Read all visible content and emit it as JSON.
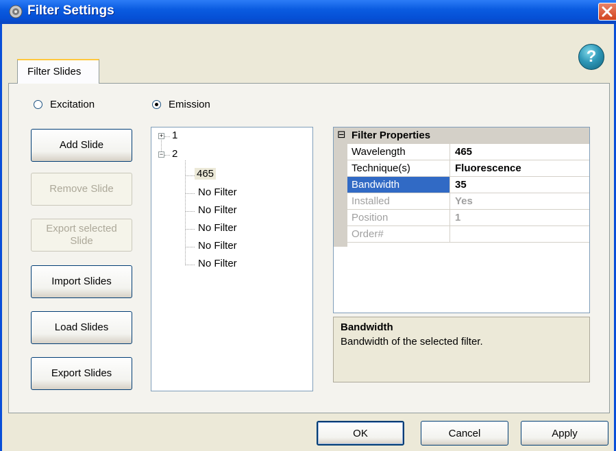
{
  "window": {
    "title": "Filter Settings"
  },
  "tabs": [
    {
      "label": "Filter Slides"
    }
  ],
  "help": {
    "glyph": "?"
  },
  "radios": {
    "excitation": {
      "label": "Excitation",
      "checked": false
    },
    "emission": {
      "label": "Emission",
      "checked": true
    }
  },
  "buttons": {
    "add_slide": "Add Slide",
    "remove_slide": "Remove Slide",
    "export_selected_line1": "Export selected",
    "export_selected_line2": "Slide",
    "import_slides": "Import Slides",
    "load_slides": "Load Slides",
    "export_slides": "Export Slides"
  },
  "tree": {
    "nodes": [
      {
        "label": "1",
        "expanded": false
      },
      {
        "label": "2",
        "expanded": true,
        "children": [
          "465",
          "No Filter",
          "No Filter",
          "No Filter",
          "No Filter",
          "No Filter"
        ]
      }
    ],
    "selected_child": "465"
  },
  "property_grid": {
    "category": "Filter Properties",
    "collapse_glyph": "⊟",
    "rows": [
      {
        "name": "Wavelength",
        "value": "465"
      },
      {
        "name": "Technique(s)",
        "value": "Fluorescence"
      },
      {
        "name": "Bandwidth",
        "value": "35"
      },
      {
        "name": "Installed",
        "value": "Yes"
      },
      {
        "name": "Position",
        "value": "1"
      },
      {
        "name": "Order#",
        "value": ""
      }
    ],
    "selected_row": "Bandwidth"
  },
  "description": {
    "title": "Bandwidth",
    "text": "Bandwidth of the selected filter."
  },
  "dialog_buttons": {
    "ok": "OK",
    "cancel": "Cancel",
    "apply": "Apply"
  },
  "colors": {
    "titlebar": "#0a5be0",
    "selection": "#316ac5",
    "dialog_bg": "#ece9d8"
  }
}
